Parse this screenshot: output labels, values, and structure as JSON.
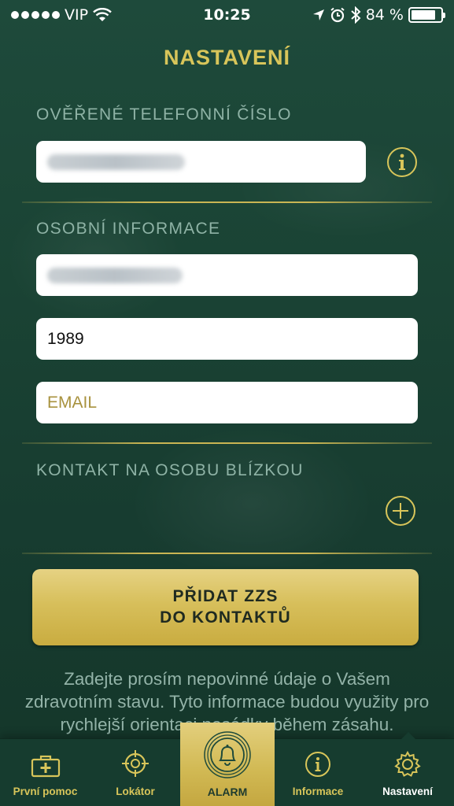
{
  "status_bar": {
    "carrier": "VIP",
    "time": "10:25",
    "battery_text": "84 %",
    "battery_level": 0.84,
    "icons": [
      "signal-dots-icon",
      "wifi-icon",
      "location-arrow-icon",
      "alarm-clock-icon",
      "bluetooth-icon",
      "battery-icon"
    ]
  },
  "header": {
    "title": "NASTAVENÍ"
  },
  "sections": {
    "phone": {
      "label": "OVĚŘENÉ TELEFONNÍ ČÍSLO"
    },
    "personal": {
      "label": "OSOBNÍ INFORMACE",
      "birth_year": "1989",
      "email_placeholder": "EMAIL"
    },
    "contact": {
      "label": "KONTAKT NA OSOBU BLÍZKOU"
    }
  },
  "add_button": {
    "line1": "PŘIDAT ZZS",
    "line2": "DO KONTAKTŮ"
  },
  "description": "Zadejte prosím nepovinné údaje o Vašem zdravotním stavu. Tyto informace budou využity pro rychlejší orientaci posádky během zásahu.",
  "tabs": [
    {
      "label": "První pomoc",
      "icon": "first-aid-kit-icon"
    },
    {
      "label": "Lokátor",
      "icon": "crosshair-icon"
    },
    {
      "label": "ALARM",
      "icon": "bell-icon"
    },
    {
      "label": "Informace",
      "icon": "info-icon"
    },
    {
      "label": "Nastavení",
      "icon": "gear-icon"
    }
  ],
  "colors": {
    "accent_gold": "#d8c55a",
    "background_green": "#1a4334",
    "label_teal": "#8fb3a6"
  }
}
